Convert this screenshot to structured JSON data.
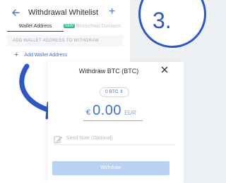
{
  "whitelist": {
    "back_icon": "arrow-left-icon",
    "title": "Withdrawal Whitelist",
    "add_icon": "plus-icon",
    "tabs": [
      {
        "label": "Wallet Address",
        "active": true
      },
      {
        "label": "Blockchain Domains",
        "badge": "NEW",
        "active": false
      }
    ],
    "section_header": "ADD WALLET ADDRESS TO WITHDRAW",
    "add_wallet_label": "Add Wallet Address"
  },
  "step": {
    "number": "3."
  },
  "withdraw": {
    "title": "Withdraw BTC (BTC)",
    "close_icon": "close-icon",
    "crypto_amount": "0 BTC",
    "currency_symbol": "€",
    "fiat_amount": "0.00",
    "fiat_unit": "EUR",
    "note_placeholder": "Send Note (Optional)",
    "note_icon": "edit-note-icon",
    "button_label": "Withdraw"
  },
  "colors": {
    "accent": "#3b73d9",
    "step_blue": "#2a57c9",
    "new_badge": "#2ec28b",
    "disabled_button": "#b9d3f5"
  }
}
